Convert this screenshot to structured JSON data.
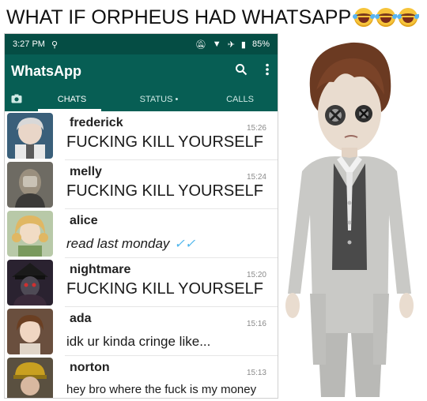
{
  "caption": "WHAT IF ORPHEUS HAD WHATSAPP",
  "status_bar": {
    "time": "3:27 PM",
    "battery": "85%"
  },
  "app": {
    "title": "WhatsApp"
  },
  "tabs": [
    {
      "label": "CHATS"
    },
    {
      "label": "STATUS •"
    },
    {
      "label": "CALLS"
    }
  ],
  "chats": [
    {
      "name": "frederick",
      "time": "15:26",
      "message": "FUCKING KILL YOURSELF"
    },
    {
      "name": "melly",
      "time": "15:24",
      "message": "FUCKING KILL YOURSELF"
    },
    {
      "name": "alice",
      "time": "",
      "message": "read last monday"
    },
    {
      "name": "nightmare",
      "time": "15:20",
      "message": "FUCKING KILL YOURSELF"
    },
    {
      "name": "ada",
      "time": "15:16",
      "message": "idk ur kinda cringe like..."
    },
    {
      "name": "norton",
      "time": "15:13",
      "message": "hey bro where the fuck is my money"
    }
  ],
  "colors": {
    "header": "#075e54",
    "statusbar": "#054d44",
    "read_ticks": "#4fb6ec"
  },
  "icons": [
    "laughing-crying-emoji",
    "camera-icon",
    "search-icon",
    "more-vert-icon",
    "double-check-icon"
  ]
}
